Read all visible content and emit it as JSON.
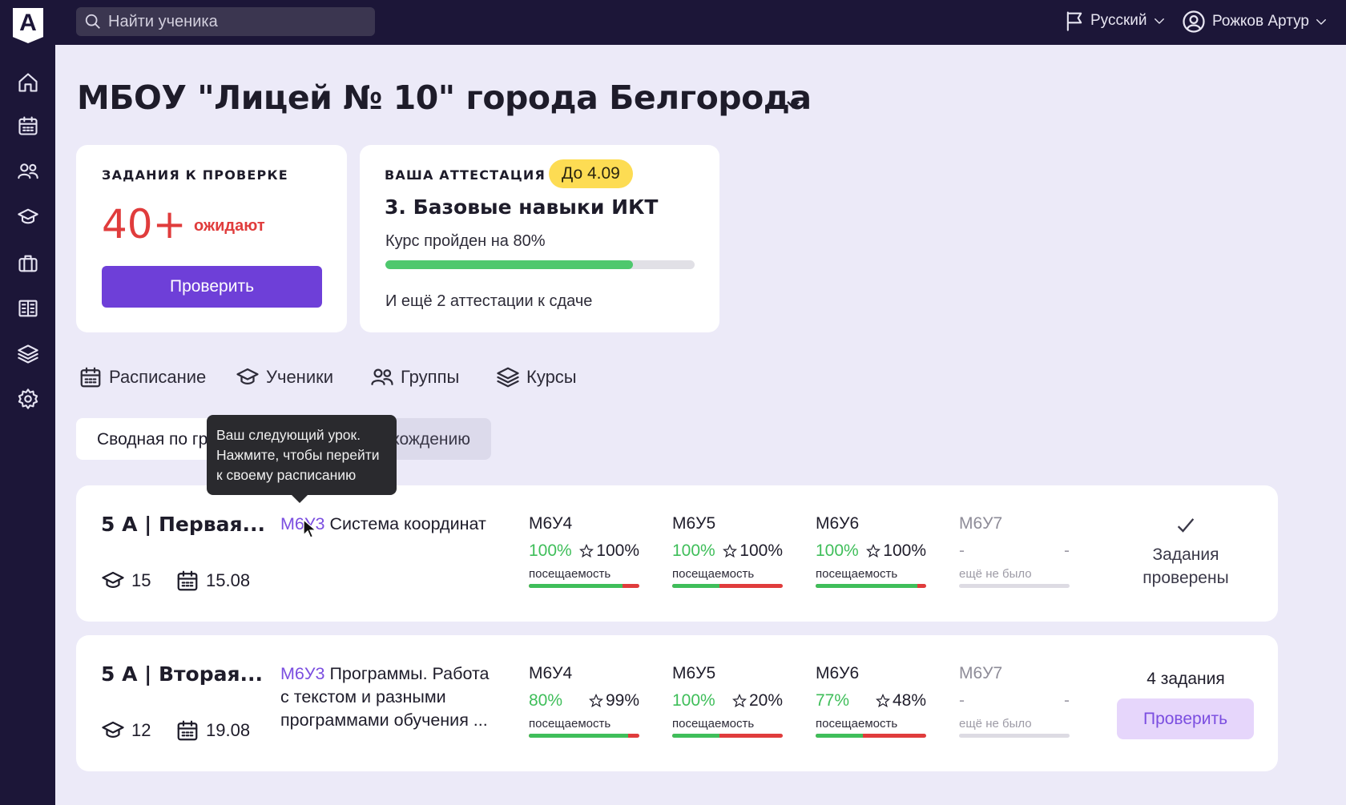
{
  "app": {
    "logo_letter": "A"
  },
  "search": {
    "placeholder": "Найти ученика"
  },
  "topbar": {
    "language": "Русский",
    "user": "Рожков Артур"
  },
  "sidebar": {
    "icons": [
      "home-icon",
      "calendar-icon",
      "users-icon",
      "graduation-cap-icon",
      "briefcase-icon",
      "journal-icon",
      "layers-icon",
      "settings-gear-icon"
    ]
  },
  "page": {
    "title": "МБОУ \"Лицей № 10\" города Белгорода"
  },
  "review_card": {
    "label": "ЗАДАНИЯ К ПРОВЕРКЕ",
    "count": "40+",
    "count_note": "ожидают",
    "button": "Проверить"
  },
  "attestation_card": {
    "label": "ВАША АТТЕСТАЦИЯ",
    "deadline": "До 4.09",
    "course": "3. Базовые навыки ИКТ",
    "progress_text": "Курс пройден на 80%",
    "progress": 0.8,
    "more": "И ещё 2 аттестации к сдаче"
  },
  "tabs": [
    {
      "label": "Расписание",
      "icon": "calendar-icon"
    },
    {
      "label": "Ученики",
      "icon": "graduation-cap-icon"
    },
    {
      "label": "Группы",
      "icon": "users-icon"
    },
    {
      "label": "Курсы",
      "icon": "layers-icon"
    }
  ],
  "view_toggle": {
    "active": "Сводная по группам",
    "second": "По прохождению"
  },
  "tooltip": {
    "line1": "Ваш следующий урок.",
    "line2": "Нажмите, чтобы перейти",
    "line3": "к своему расписанию"
  },
  "colors": {
    "accent": "#6e3fd8",
    "danger": "#e03c3c",
    "success": "#3fbe5a",
    "badge": "#fddc53",
    "sidebar": "#1c1638"
  },
  "groups": [
    {
      "name": "5 А | Первая...",
      "students": "15",
      "date": "15.08",
      "lesson_code": "М6У3",
      "lesson_title": "Система координат",
      "lessons": [
        {
          "code": "М6У4",
          "attendance": "100%",
          "rating": "100%",
          "caption": "посещаемость",
          "attendance_value": 0.85
        },
        {
          "code": "М6У5",
          "attendance": "100%",
          "rating": "100%",
          "caption": "посещаемость",
          "attendance_value": 0.43
        },
        {
          "code": "М6У6",
          "attendance": "100%",
          "rating": "100%",
          "caption": "посещаемость",
          "attendance_value": 0.92
        }
      ],
      "future": {
        "code": "М6У7",
        "dash1": "-",
        "dash2": "-",
        "caption": "ещё не было"
      },
      "status_line1": "Задания",
      "status_line2": "проверены"
    },
    {
      "name": "5 А | Вторая...",
      "students": "12",
      "date": "19.08",
      "lesson_code": "М6У3",
      "lesson_title": "Программы. Работа с текстом и разными программами обучения ...",
      "lessons": [
        {
          "code": "М6У4",
          "attendance": "80%",
          "rating": "99%",
          "caption": "посещаемость",
          "attendance_value": 0.9
        },
        {
          "code": "М6У5",
          "attendance": "100%",
          "rating": "20%",
          "caption": "посещаемость",
          "attendance_value": 0.43
        },
        {
          "code": "М6У6",
          "attendance": "77%",
          "rating": "48%",
          "caption": "посещаемость",
          "attendance_value": 0.43
        }
      ],
      "future": {
        "code": "М6У7",
        "dash1": "-",
        "dash2": "-",
        "caption": "ещё не было"
      },
      "tasks": "4 задания",
      "button": "Проверить"
    }
  ]
}
